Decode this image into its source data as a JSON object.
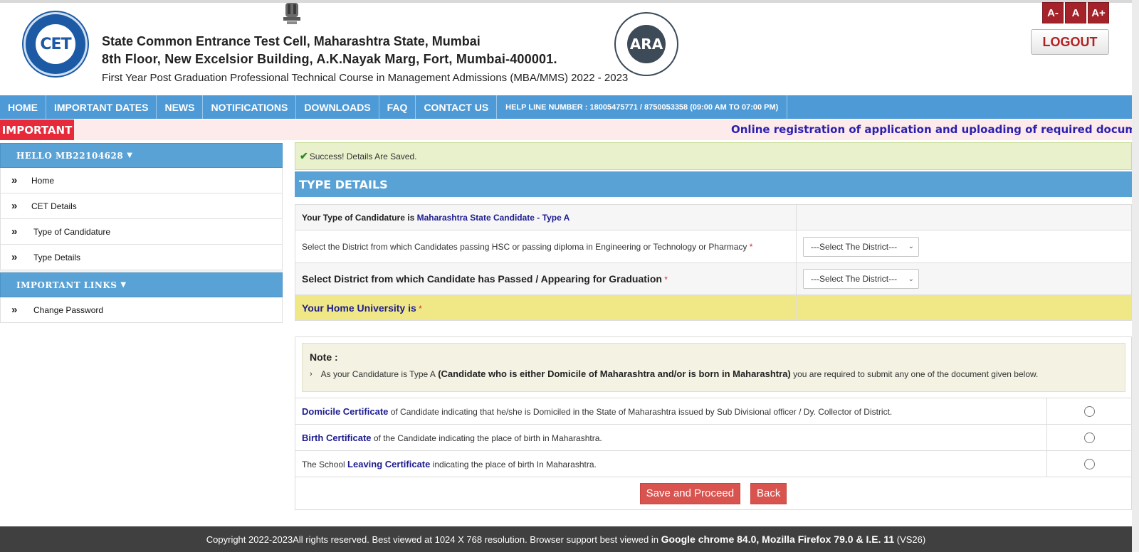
{
  "header": {
    "cet_logo_text": "CET",
    "ara_logo_text": "ARA",
    "line1": "State Common Entrance Test Cell, Maharashtra State, Mumbai",
    "line2": "8th Floor, New Excelsior Building, A.K.Nayak Marg, Fort, Mumbai-400001.",
    "line3": "First Year Post Graduation Professional Technical Course in Management Admissions (MBA/MMS) 2022 - 2023",
    "font_buttons": [
      "A-",
      "A",
      "A+"
    ],
    "logout_label": "LOGOUT"
  },
  "nav": {
    "items": [
      "HOME",
      "IMPORTANT DATES",
      "NEWS",
      "NOTIFICATIONS",
      "DOWNLOADS",
      "FAQ",
      "CONTACT US"
    ],
    "helpline": "HELP LINE NUMBER : 18005475771 / 8750053358 (09:00 AM TO 07:00 PM)"
  },
  "marquee": {
    "label": "IMPORTANT",
    "text": "Online registration of application and uploading of required documents by"
  },
  "sidebar": {
    "user_heading": "HELLO MB22104628",
    "items": [
      "Home",
      "CET Details",
      "Type of Candidature",
      "Type Details"
    ],
    "links_heading": "IMPORTANT LINKS",
    "links": [
      "Change Password"
    ]
  },
  "main": {
    "success_text": "Success! Details Are Saved.",
    "section_title": "TYPE DETAILS",
    "candidature_prefix": "Your Type of Candidature is",
    "candidature_value": "Maharashtra State Candidate - Type A",
    "hsc_district_label": "Select the District from which Candidates passing HSC or passing diploma in Engineering or Technology or Pharmacy",
    "hsc_district_value": "---Select The District---",
    "grad_district_label": "Select District from which Candidate has Passed / Appearing for Graduation",
    "grad_district_value": "---Select The District---",
    "home_university_label": "Your Home University is",
    "required_mark": "*",
    "note_title": "Note :",
    "note_prefix": "As your Candidature is Type A",
    "note_bold": "(Candidate who is either Domicile of Maharashtra and/or is born in Maharashtra)",
    "note_suffix": "you are required to submit any one of the document given below.",
    "docs": [
      {
        "before": "",
        "title": "Domicile Certificate",
        "after": " of Candidate indicating that he/she is Domiciled in the State of Maharashtra issued by Sub Divisional officer / Dy. Collector of District."
      },
      {
        "before": "",
        "title": "Birth Certificate",
        "after": " of the Candidate indicating the place of birth in Maharashtra."
      },
      {
        "before": "The School ",
        "title": "Leaving Certificate",
        "after": " indicating the place of birth In Maharashtra."
      }
    ],
    "save_button": "Save and Proceed",
    "back_button": "Back"
  },
  "footer": {
    "prefix": "Copyright 2022-2023All rights reserved. Best viewed at 1024 X 768 resolution. Browser support best viewed in",
    "browsers": "Google chrome 84.0, Mozilla Firefox 79.0 & I.E. 11",
    "suffix": "(VS26)"
  },
  "colors": {
    "nav_blue": "#4d9ad6",
    "important_red": "#e62a3a",
    "button_red": "#d9534f",
    "link_blue": "#1d1c8f",
    "university_row": "#f0e887"
  }
}
